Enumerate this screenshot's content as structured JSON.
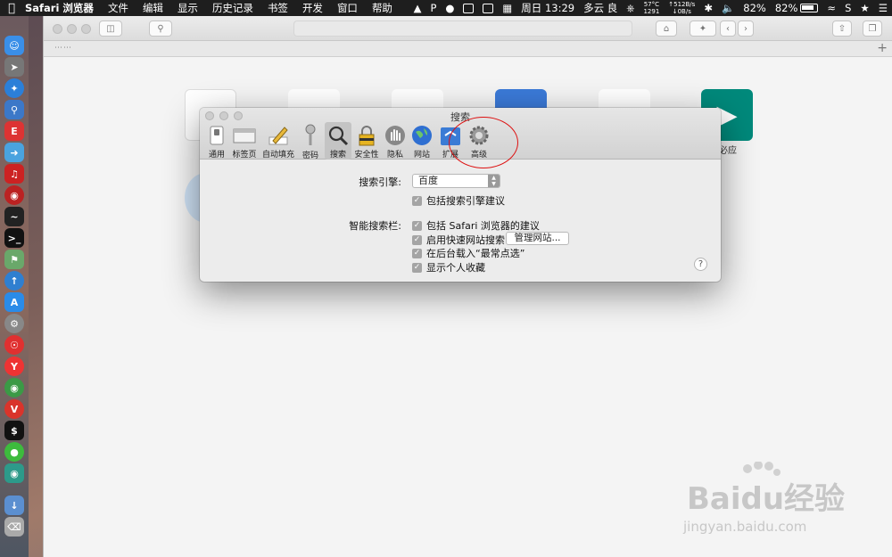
{
  "menubar": {
    "app_name": "Safari 浏览器",
    "items": [
      "文件",
      "编辑",
      "显示",
      "历史记录",
      "书签",
      "开发",
      "窗口",
      "帮助"
    ],
    "status": {
      "datetime": "周日 13:29",
      "weather": "多云 良",
      "temp": "57°C",
      "fan": "1291",
      "net_up": "↑512B/s",
      "net_down": "↓0B/s",
      "battery_1": "82%",
      "battery_2": "82%"
    }
  },
  "favorites": {
    "bing_label": "必应"
  },
  "prefs": {
    "title": "搜索",
    "tabs": [
      {
        "label": "通用",
        "icon": "switch-icon"
      },
      {
        "label": "标签页",
        "icon": "tabs-icon"
      },
      {
        "label": "自动填充",
        "icon": "pencil-icon"
      },
      {
        "label": "密码",
        "icon": "key-icon"
      },
      {
        "label": "搜索",
        "icon": "magnifier-icon"
      },
      {
        "label": "安全性",
        "icon": "lock-icon"
      },
      {
        "label": "隐私",
        "icon": "hand-icon"
      },
      {
        "label": "网站",
        "icon": "globe-icon"
      },
      {
        "label": "扩展",
        "icon": "puzzle-icon"
      },
      {
        "label": "高级",
        "icon": "gear-icon"
      }
    ],
    "search_engine_label": "搜索引擎:",
    "search_engine_value": "百度",
    "include_suggestions": "包括搜索引擎建议",
    "smart_bar_label": "智能搜索栏:",
    "smart_options": [
      "包括 Safari 浏览器的建议",
      "启用快速网站搜索",
      "在后台载入“最常点选”",
      "显示个人收藏"
    ],
    "manage_button": "管理网站...",
    "help": "?"
  },
  "watermark": {
    "main": "Baidu经验",
    "sub": "jingyan.baidu.com"
  },
  "colors": {
    "accent_red": "#d11111",
    "bing_green": "#00897b"
  }
}
